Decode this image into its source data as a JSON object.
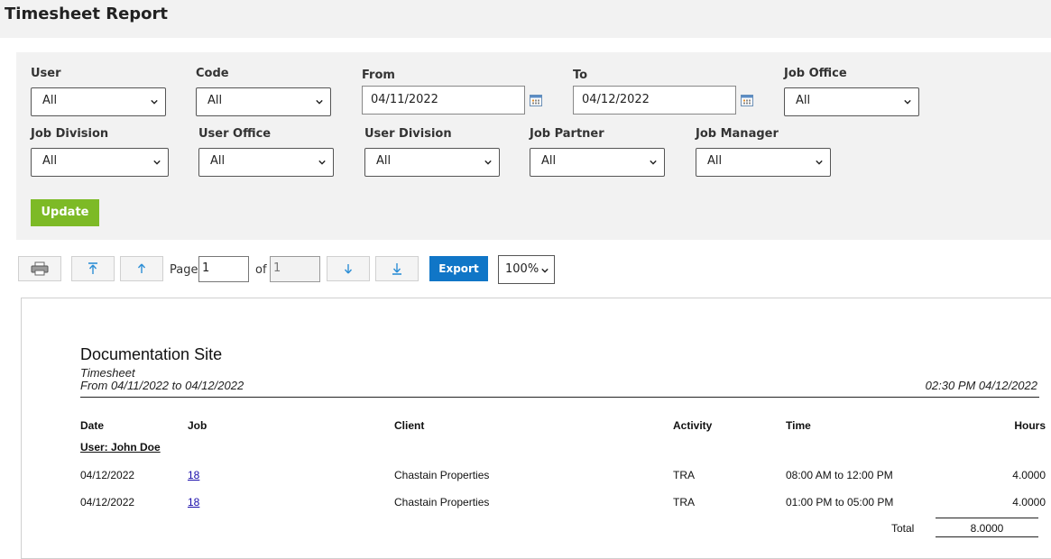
{
  "page": {
    "title": "Timesheet Report"
  },
  "filters": {
    "user": {
      "label": "User",
      "value": "All"
    },
    "code": {
      "label": "Code",
      "value": "All"
    },
    "from": {
      "label": "From",
      "value": "04/11/2022"
    },
    "to": {
      "label": "To",
      "value": "04/12/2022"
    },
    "job_office": {
      "label": "Job Office",
      "value": "All"
    },
    "job_division": {
      "label": "Job Division",
      "value": "All"
    },
    "user_office": {
      "label": "User Office",
      "value": "All"
    },
    "user_division": {
      "label": "User Division",
      "value": "All"
    },
    "job_partner": {
      "label": "Job Partner",
      "value": "All"
    },
    "job_manager": {
      "label": "Job Manager",
      "value": "All"
    },
    "update_label": "Update"
  },
  "toolbar": {
    "page_label": "Page",
    "page_value": "1",
    "of_label": "of",
    "page_total": "1",
    "export_label": "Export",
    "zoom_value": "100%"
  },
  "report": {
    "org_name": "Documentation Site",
    "report_name": "Timesheet",
    "date_range": "From 04/11/2022 to 04/12/2022",
    "generated": "02:30 PM 04/12/2022",
    "columns": {
      "date": "Date",
      "job": "Job",
      "client": "Client",
      "activity": "Activity",
      "time": "Time",
      "hours": "Hours"
    },
    "group_label": "User: John Doe",
    "rows": [
      {
        "date": "04/12/2022",
        "job": "18",
        "client": "Chastain Properties",
        "activity": "TRA",
        "time": "08:00 AM to 12:00 PM",
        "hours": "4.0000"
      },
      {
        "date": "04/12/2022",
        "job": "18",
        "client": "Chastain Properties",
        "activity": "TRA",
        "time": "01:00 PM to 05:00 PM",
        "hours": "4.0000"
      }
    ],
    "total_label": "Total",
    "total_value": "8.0000"
  },
  "colors": {
    "update_green": "#7dba26",
    "export_blue": "#1076c7",
    "panel_gray": "#f2f2f2"
  }
}
